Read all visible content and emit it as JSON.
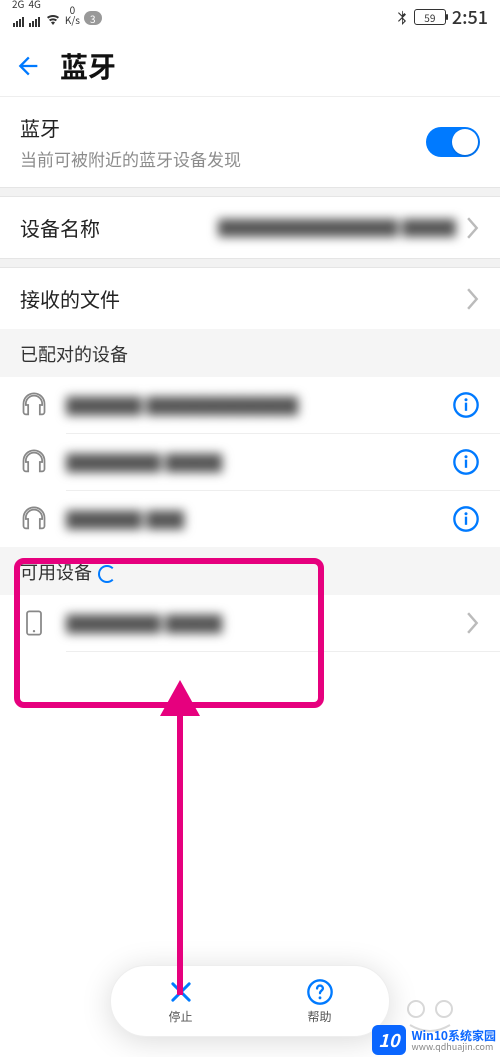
{
  "statusbar": {
    "net1": "2G",
    "net2": "4G",
    "speed_top": "0",
    "speed_bottom": "K/s",
    "notif_count": "3",
    "battery": "59",
    "time": "2:51"
  },
  "header": {
    "title": "蓝牙"
  },
  "rows": {
    "bt_label": "蓝牙",
    "bt_sub": "当前可被附近的蓝牙设备发现",
    "device_name_label": "设备名称",
    "device_name_value": "██████████ ███",
    "received_files_label": "接收的文件"
  },
  "sections": {
    "paired_header": "已配对的设备",
    "paired": [
      {
        "name": "████ ████████"
      },
      {
        "name": "█████ ███"
      },
      {
        "name": "████ ██"
      }
    ],
    "available_header": "可用设备",
    "available": [
      {
        "name": "█████ ███"
      }
    ]
  },
  "bottom": {
    "stop": "停止",
    "help": "帮助"
  },
  "watermark": {
    "badge": "10",
    "line1": "Win10系统家园",
    "line2": "www.qdhuajin.com"
  }
}
